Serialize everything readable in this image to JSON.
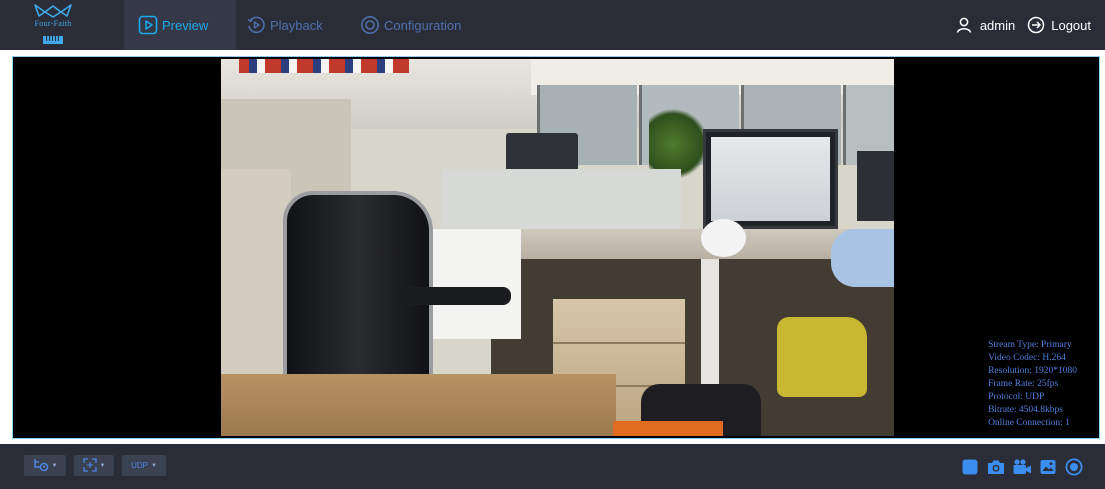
{
  "brand": {
    "name": "Four-Faith",
    "badge": "IIIII"
  },
  "nav": {
    "tabs": [
      {
        "label": "Preview",
        "icon": "play-square-icon",
        "active": true
      },
      {
        "label": "Playback",
        "icon": "replay-circle-icon",
        "active": false
      },
      {
        "label": "Configuration",
        "icon": "settings-circle-icon",
        "active": false
      }
    ]
  },
  "user": {
    "name": "admin",
    "logout_label": "Logout"
  },
  "stream_info": {
    "stream_type": "Stream Type: Primary",
    "video_codec": "Video Codec: H.264",
    "resolution": "Resolution: 1920*1080",
    "frame_rate": "Frame Rate: 25fps",
    "protocol": "Protocol: UDP",
    "bitrate": "Bitrate: 4504.8kbps",
    "online_connection": "Online Connection: 1"
  },
  "controls": {
    "ptz_icon": "ptz-control-icon",
    "zoom_icon": "zoom-fit-icon",
    "protocol_label": "UDP"
  },
  "actions": [
    {
      "icon": "stop-square-icon"
    },
    {
      "icon": "camera-snapshot-icon"
    },
    {
      "icon": "video-record-icon"
    },
    {
      "icon": "image-gallery-icon"
    },
    {
      "icon": "live-record-icon"
    }
  ],
  "colors": {
    "bar_background": "#2a2d38",
    "active_tab": "#1aa9ec",
    "inactive_tab": "#4d6fa8",
    "action_icon": "#3b8df0",
    "stream_text": "#4f7fe0"
  }
}
